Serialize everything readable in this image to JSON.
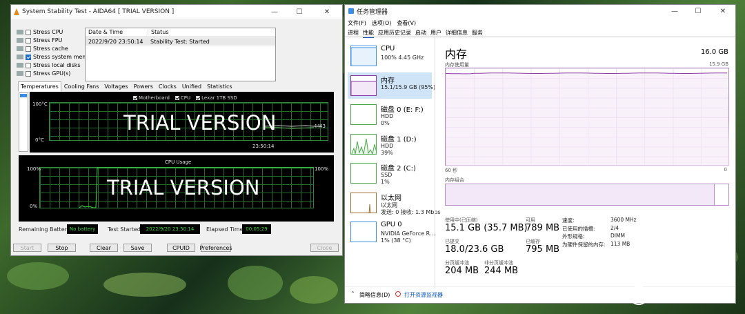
{
  "aida": {
    "title": "System Stability Test - AIDA64  [ TRIAL VERSION ]",
    "stress": [
      "Stress CPU",
      "Stress FPU",
      "Stress cache",
      "Stress system memory",
      "Stress local disks",
      "Stress GPU(s)"
    ],
    "stress_checked": [
      false,
      false,
      false,
      true,
      false,
      false
    ],
    "log": {
      "col_date": "Date & Time",
      "col_status": "Status",
      "date": "2022/9/20 23:50:14",
      "status": "Stability Test: Started"
    },
    "tabs": [
      "Temperatures",
      "Cooling Fans",
      "Voltages",
      "Powers",
      "Clocks",
      "Unified",
      "Statistics"
    ],
    "temp_graph": {
      "legend": [
        "Motherboard",
        "CPU",
        "Lexar 1TB SSD"
      ],
      "y_top": "100°C",
      "y_bottom": "0°C",
      "time": "23:50:14",
      "value_a": "44",
      "value_b": "43",
      "watermark": "TRIAL VERSION"
    },
    "cpu_graph": {
      "title": "CPU Usage",
      "y_top": "100%",
      "y_bottom": "0%",
      "value": "100%",
      "watermark": "TRIAL VERSION"
    },
    "status": {
      "battery_label": "Remaining Battery:",
      "battery": "No battery",
      "started_label": "Test Started:",
      "started": "2022/9/20 23:50:14",
      "elapsed_label": "Elapsed Time:",
      "elapsed": "00:05:29"
    },
    "buttons": [
      "Start",
      "Stop",
      "Clear",
      "Save",
      "CPUID",
      "Preferences",
      "Close"
    ]
  },
  "tm": {
    "title": "任务管理器",
    "menu": [
      "文件(F)",
      "选项(O)",
      "查看(V)"
    ],
    "tabs": [
      "进程",
      "性能",
      "应用历史记录",
      "启动",
      "用户",
      "详细信息",
      "服务"
    ],
    "items": [
      {
        "name": "CPU",
        "sub1": "100%  4.45 GHz",
        "sub2": ""
      },
      {
        "name": "内存",
        "sub1": "15.1/15.9 GB (95%)",
        "sub2": ""
      },
      {
        "name": "磁盘 0 (E: F:)",
        "sub1": "HDD",
        "sub2": "0%"
      },
      {
        "name": "磁盘 1 (D:)",
        "sub1": "HDD",
        "sub2": "39%"
      },
      {
        "name": "磁盘 2 (C:)",
        "sub1": "SSD",
        "sub2": "1%"
      },
      {
        "name": "以太网",
        "sub1": "以太网",
        "sub2": "发送: 0  接收: 1.3 Mbps"
      },
      {
        "name": "GPU 0",
        "sub1": "NVIDIA GeForce R...",
        "sub2": "1% (38 °C)"
      }
    ],
    "heading": "内存",
    "total": "16.0 GB",
    "usage_label": "内存使用量",
    "usage_max": "15.9 GB",
    "axis_left": "60 秒",
    "axis_right": "0",
    "composition_label": "内存组合",
    "stats": {
      "in_use_label": "使用中(已压缩)",
      "in_use": "15.1 GB (35.7 MB)",
      "available_label": "可用",
      "available": "789 MB",
      "committed_label": "已提交",
      "committed": "18.0/23.6 GB",
      "cached_label": "已缓存",
      "cached": "795 MB",
      "paged_label": "分页缓冲池",
      "paged": "204 MB",
      "nonpaged_label": "非分页缓冲池",
      "nonpaged": "244 MB"
    },
    "props": [
      {
        "k": "速度:",
        "v": "3600 MHz"
      },
      {
        "k": "已使用的插槽:",
        "v": "2/4"
      },
      {
        "k": "外形规格:",
        "v": "DIMM"
      },
      {
        "k": "为硬件保留的内存:",
        "v": "113 MB"
      }
    ],
    "footer_less": "简略信息(D)",
    "footer_monitor": "打开资源监视器"
  },
  "watermark": "值 什么值得买",
  "colors": {
    "mem_line": "#8b3aa8",
    "mem_fill": "#f3e8f7",
    "graph_green": "#2c8a3a",
    "cpu_line": "#3fdc3f"
  },
  "mem_usage_fraction": 0.95
}
